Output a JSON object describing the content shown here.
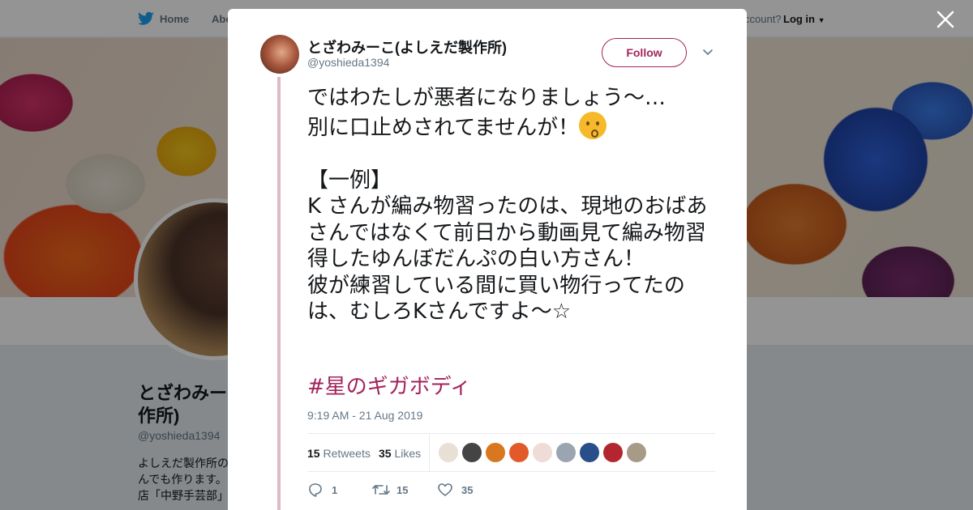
{
  "nav": {
    "home_label": "Home",
    "about_label": "Abo",
    "account_prompt": "ccount?",
    "login_label": "Log in"
  },
  "profile": {
    "name": "とざわみーこ(よしえだ製作所)",
    "name_visible": "とざわみー\n作所)",
    "handle": "@yoshieda1394",
    "bio_visible": "よしえだ製作所の\nんでも作ります。\n店「中野手芸部」"
  },
  "tweet": {
    "author_name": "とざわみーこ(よしえだ製作所)",
    "author_handle": "@yoshieda1394",
    "follow_label": "Follow",
    "text_paragraphs": [
      "ではわたしが悪者になりましょう～…\n別に口止めされてませんが！",
      "【一例】\nK さんが編み物習ったのは、現地のおばあさんではなくて前日から動画見て編み物習得したゆんぼだんぷの白い方さん！\n彼が練習している間に買い物行ってたのは、むしろKさんですよ～☆"
    ],
    "emoji_name": "kissing-face-emoji",
    "hashtag": "#星のギガボディ",
    "timestamp": "9:19 AM - 21 Aug 2019",
    "retweets_count": "15",
    "retweets_label": "Retweets",
    "likes_count": "35",
    "likes_label": "Likes",
    "liker_avatars": [
      "#e8dfd5",
      "#444444",
      "#d9771f",
      "#e25a2a",
      "#f0dcd6",
      "#9aa5b1",
      "#2a4e8a",
      "#b3262f",
      "#a79a87"
    ],
    "actions": {
      "reply_count": "1",
      "retweet_count": "15",
      "like_count": "35"
    }
  },
  "colors": {
    "accent": "#a3235c",
    "thread_line": "#e1b8c6",
    "text_secondary": "#657786",
    "twitter_blue": "#1da1f2"
  }
}
